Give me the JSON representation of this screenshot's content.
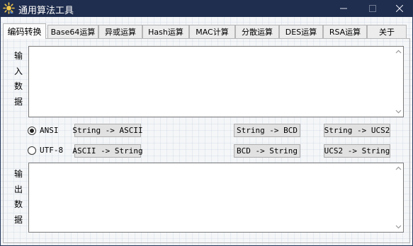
{
  "window": {
    "title": "通用算法工具"
  },
  "tabs": [
    {
      "label": "编码转换",
      "active": true
    },
    {
      "label": "Base64运算"
    },
    {
      "label": "异或运算"
    },
    {
      "label": "Hash运算"
    },
    {
      "label": "MAC计算"
    },
    {
      "label": "分散运算"
    },
    {
      "label": "DES运算"
    },
    {
      "label": "RSA运算"
    },
    {
      "label": "关于"
    }
  ],
  "input_area": {
    "label_chars": [
      "输",
      "入",
      "数",
      "据"
    ],
    "value": ""
  },
  "output_area": {
    "label_chars": [
      "输",
      "出",
      "数",
      "据"
    ],
    "value": ""
  },
  "encoding": {
    "options": [
      {
        "label": "ANSI",
        "selected": true
      },
      {
        "label": "UTF-8",
        "selected": false
      }
    ]
  },
  "buttons": {
    "string_to_ascii": "String -> ASCII",
    "ascii_to_string": "ASCII -> String",
    "string_to_bcd": "String -> BCD",
    "bcd_to_string": "BCD -> String",
    "string_to_ucs2": "String -> UCS2",
    "ucs2_to_string": "UCS2 -> String"
  },
  "colors": {
    "titlebar": "#1f2d4e",
    "button_face": "#e1e1e1",
    "tab_border": "#b5b5b5"
  },
  "icons": {
    "app": "app-sun-icon",
    "minimize": "minimize-icon",
    "maximize": "maximize-icon",
    "close": "close-icon"
  }
}
